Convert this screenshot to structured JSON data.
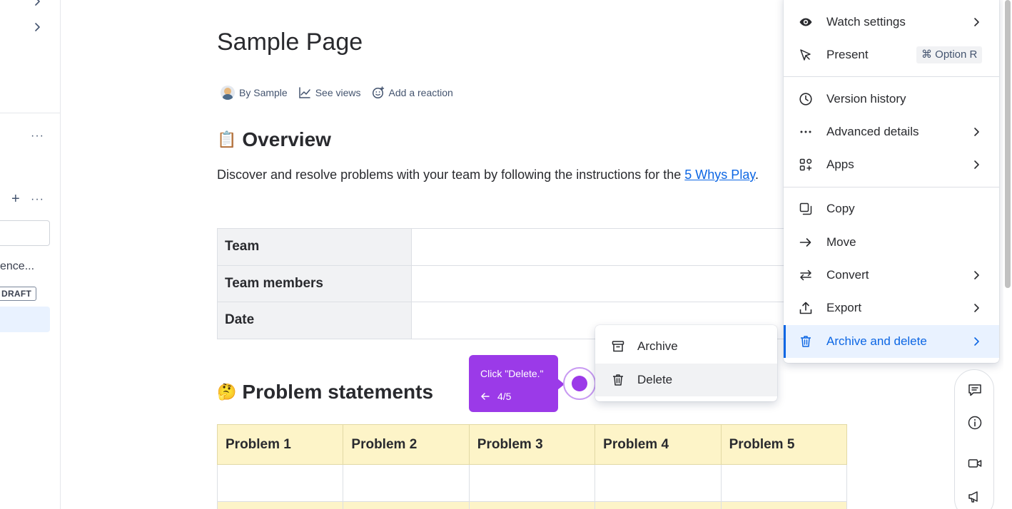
{
  "sidebar": {
    "truncated_item": "ence...",
    "draft_badge": "DRAFT"
  },
  "page": {
    "title": "Sample Page",
    "byline": {
      "author": "By Sample",
      "views": "See views",
      "reaction": "Add a reaction"
    },
    "overview": {
      "emoji": "📋",
      "heading": "Overview",
      "text_before": "Discover and resolve problems with your team by following the instructions for the ",
      "link": "5 Whys Play",
      "text_after": "."
    },
    "info_table": {
      "rows": [
        "Team",
        "Team members",
        "Date"
      ]
    },
    "problems": {
      "emoji": "🤔",
      "heading": "Problem statements",
      "columns": [
        "Problem 1",
        "Problem 2",
        "Problem 3",
        "Problem 4",
        "Problem 5"
      ]
    }
  },
  "menu": {
    "items": [
      {
        "label": "Watch settings",
        "icon": "eye-icon",
        "submenu": true
      },
      {
        "label": "Present",
        "icon": "present-icon",
        "shortcut": "⌘ Option R"
      },
      {
        "label": "Version history",
        "icon": "clock-icon"
      },
      {
        "label": "Advanced details",
        "icon": "more-icon",
        "submenu": true
      },
      {
        "label": "Apps",
        "icon": "apps-icon",
        "submenu": true
      },
      {
        "label": "Copy",
        "icon": "copy-icon"
      },
      {
        "label": "Move",
        "icon": "arrow-right-icon"
      },
      {
        "label": "Convert",
        "icon": "convert-icon",
        "submenu": true
      },
      {
        "label": "Export",
        "icon": "export-icon",
        "submenu": true
      },
      {
        "label": "Archive and delete",
        "icon": "trash-icon",
        "submenu": true,
        "active": true
      }
    ]
  },
  "submenu": {
    "items": [
      {
        "label": "Archive",
        "icon": "archive-icon"
      },
      {
        "label": "Delete",
        "icon": "trash-icon",
        "hovered": true
      }
    ]
  },
  "guide": {
    "text": "Click \"Delete.\"",
    "step": "4/5"
  },
  "colors": {
    "accent": "#0c66e4",
    "guide_purple": "#9b3ae8",
    "table_header_yellow": "#fdf4c8",
    "table_label_gray": "#f1f2f4"
  }
}
